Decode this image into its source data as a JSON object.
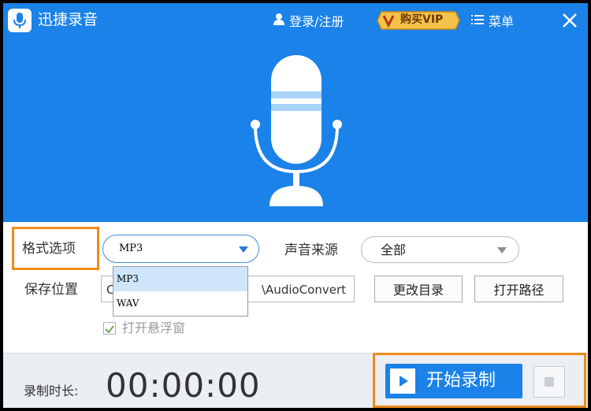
{
  "app": {
    "title": "迅捷录音",
    "login_label": "登录/注册",
    "vip_label": "购买VIP",
    "menu_label": "菜单",
    "icons": {
      "logo": "microphone-logo-icon",
      "user": "user-icon",
      "vip": "vip-badge-icon",
      "menu": "hamburger-menu-icon",
      "close": "close-icon",
      "hero": "microphone-icon"
    }
  },
  "settings": {
    "format_label": "格式选项",
    "format_value": "MP3",
    "format_options": [
      "MP3",
      "WAV"
    ],
    "source_label": "声音来源",
    "source_value": "全部",
    "save_label": "保存位置",
    "save_path_prefix": "C",
    "save_path_suffix": "\\AudioConvert",
    "change_dir_label": "更改目录",
    "open_path_label": "打开路径",
    "float_window_label": "打开悬浮窗",
    "float_window_checked": true
  },
  "recorder": {
    "duration_label": "录制时长:",
    "time": "00:00:00",
    "start_label": "开始录制"
  },
  "colors": {
    "primary": "#1a82e8",
    "highlight": "#f08a1c",
    "vip_gold": "#f4c24a"
  }
}
